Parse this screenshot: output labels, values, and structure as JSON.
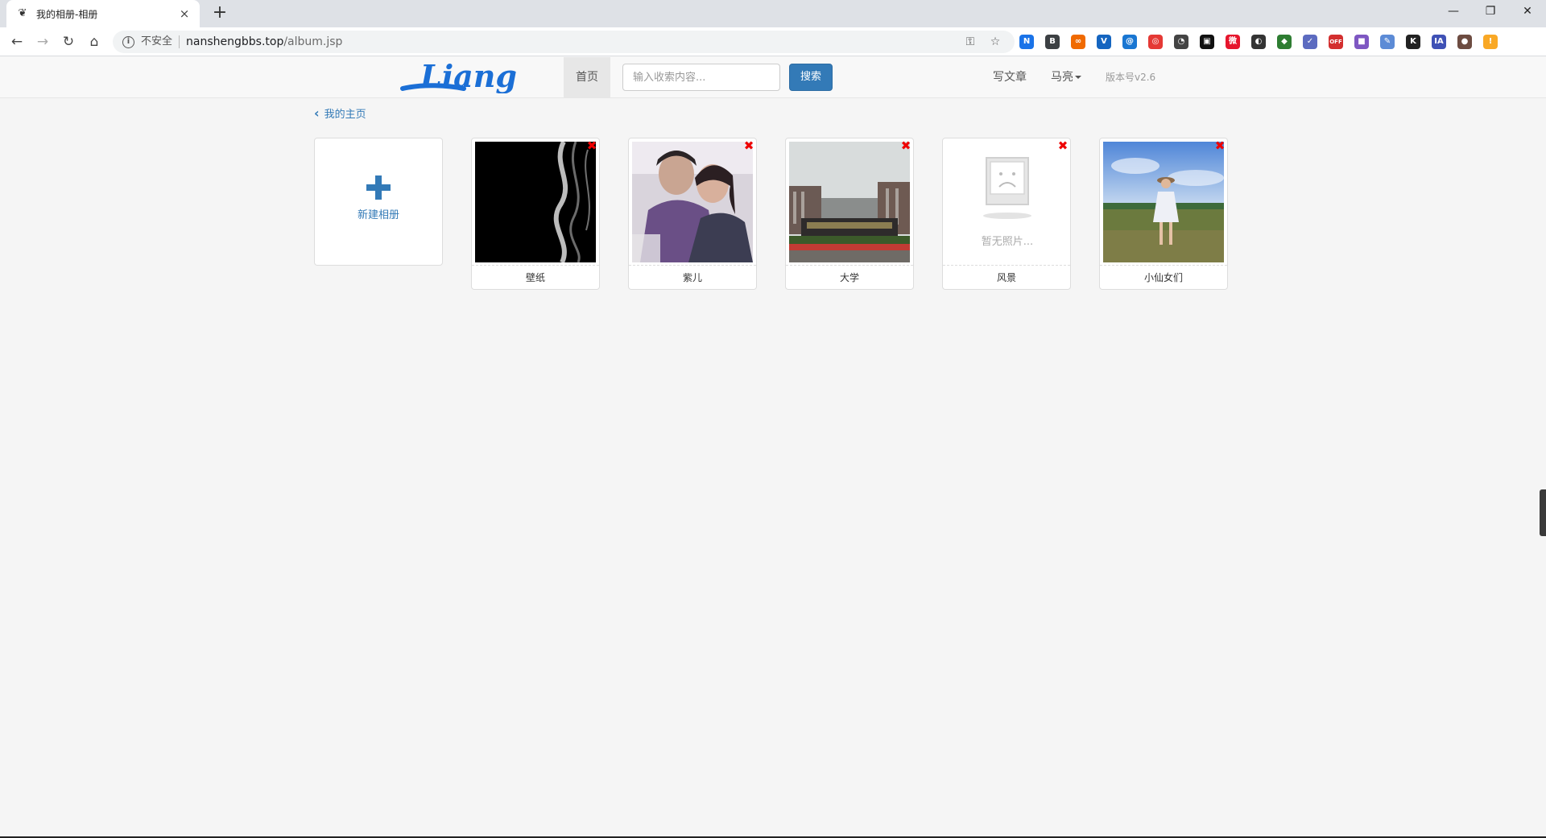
{
  "browser": {
    "tab": {
      "title": "我的相册-相册",
      "close": "×"
    },
    "new_tab": "+",
    "window": {
      "minimize": "—",
      "restore": "❐",
      "close": "✕"
    },
    "nav": {
      "back": "←",
      "forward": "→",
      "reload": "↻",
      "home": "⌂"
    },
    "address": {
      "security_label": "不安全",
      "host": "nanshengbbs.top",
      "path": "/album.jsp"
    },
    "extensions": [
      {
        "name": "new-extension-icon",
        "text": "N",
        "color": "#1a73e8"
      },
      {
        "name": "b-extension-icon",
        "text": "B",
        "color": "#3c4043"
      },
      {
        "name": "infinity-extension-icon",
        "text": "∞",
        "color": "#f06a00"
      },
      {
        "name": "v-extension-icon",
        "text": "V",
        "color": "#1565c0"
      },
      {
        "name": "at-extension-icon",
        "text": "@",
        "color": "#1976d2"
      },
      {
        "name": "spiral-extension-icon",
        "text": "◎",
        "color": "#e53935"
      },
      {
        "name": "speed-extension-icon",
        "text": "◔",
        "color": "#444444"
      },
      {
        "name": "square-extension-icon",
        "text": "▣",
        "color": "#111111"
      },
      {
        "name": "weibo-extension-icon",
        "text": "微",
        "color": "#e6162d"
      },
      {
        "name": "dark-circle-extension-icon",
        "text": "◐",
        "color": "#333333"
      },
      {
        "name": "shield-extension-icon",
        "text": "◆",
        "color": "#2e7d32"
      },
      {
        "name": "check-extension-icon",
        "text": "✓",
        "color": "#5c6bc0"
      },
      {
        "name": "off-extension-icon",
        "text": "OFF",
        "color": "#d32f2f"
      },
      {
        "name": "purple-extension-icon",
        "text": "■",
        "color": "#7e57c2"
      },
      {
        "name": "note-extension-icon",
        "text": "✎",
        "color": "#5c8bd6"
      },
      {
        "name": "k-extension-icon",
        "text": "K",
        "color": "#222222"
      },
      {
        "name": "ia-extension-icon",
        "text": "IA",
        "color": "#3f51b5"
      },
      {
        "name": "avatar-extension-icon",
        "text": "●",
        "color": "#6d4c41"
      },
      {
        "name": "update-extension-icon",
        "text": "!",
        "color": "#f9a825"
      }
    ]
  },
  "site": {
    "nav": {
      "home": "首页",
      "search_placeholder": "输入收索内容...",
      "search_button": "搜索",
      "write": "写文章",
      "user": "马亮",
      "version": "版本号v2.6"
    },
    "breadcrumb": {
      "chevron": "‹",
      "label": "我的主页"
    },
    "new_album_label": "新建相册",
    "albums": [
      {
        "name": "壁纸",
        "delete": "✖",
        "thumb": "smoke-photo"
      },
      {
        "name": "紫儿",
        "delete": "✖",
        "thumb": "couple-photo"
      },
      {
        "name": "大学",
        "delete": "✖",
        "thumb": "campus-photo"
      },
      {
        "name": "风景",
        "delete": "✖",
        "thumb": "empty",
        "empty_text": "暂无照片..."
      },
      {
        "name": "小仙女们",
        "delete": "✖",
        "thumb": "field-photo"
      }
    ],
    "logo_text": "Liang"
  }
}
